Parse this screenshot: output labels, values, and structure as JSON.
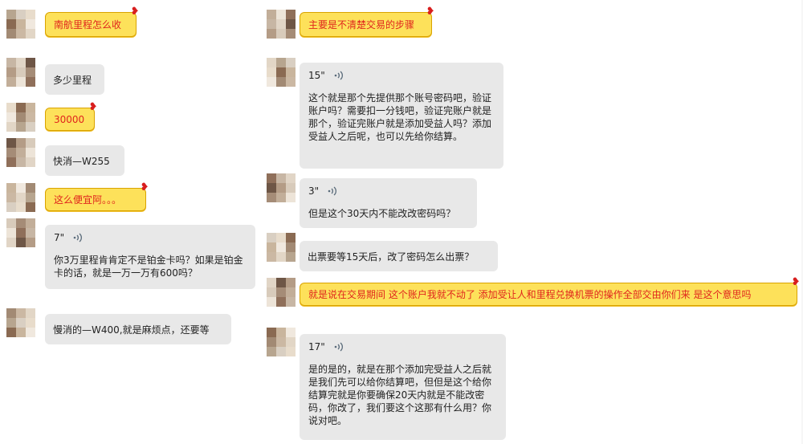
{
  "colors": {
    "gray_bubble": "#e8e8e8",
    "highlight_bubble": "#fde15a",
    "highlight_text": "#e0251d"
  },
  "icons": {
    "voice": "sound-wave-icon",
    "heart": "heart-icon",
    "avatar": "pixelated-avatar"
  },
  "left": [
    {
      "type": "highlight",
      "text": "南航里程怎么收"
    },
    {
      "type": "text",
      "text": "多少里程"
    },
    {
      "type": "highlight",
      "text": "30000"
    },
    {
      "type": "text",
      "text": "快消—W255"
    },
    {
      "type": "highlight",
      "text": "这么便宜阿。。。"
    },
    {
      "type": "voice",
      "duration": "7\"",
      "text": "你3万里程肯肯定不是铂金卡吗？如果是铂金卡的话，就是一万一万有600吗？"
    },
    {
      "type": "text",
      "text": "慢消的—W400,就是麻烦点，还要等"
    }
  ],
  "right": [
    {
      "type": "highlight",
      "text": "主要是不清楚交易的步骤"
    },
    {
      "type": "voice",
      "duration": "15\"",
      "text": "这个就是那个先提供那个账号密码吧，验证账户吗？需要扣一分钱吧，验证完账户就是那个，验证完账户就是添加受益人吗？添加受益人之后呢，也可以先给你结算。"
    },
    {
      "type": "voice",
      "duration": "3\"",
      "text": "但是这个30天内不能改改密码吗？"
    },
    {
      "type": "text",
      "text": "出票要等15天后，改了密码怎么出票？"
    },
    {
      "type": "highlight",
      "text": "就是说在交易期间  这个账户我就不动了 添加受让人和里程兑换机票的操作全部交由你们来 是这个意思吗"
    },
    {
      "type": "voice",
      "duration": "17\"",
      "text": "是的是的，就是在那个添加完受益人之后就是我们先可以给你结算吧，但但是这个给你结算完就是你要确保20天内就是不能改密码，你改了，我们要这个这那有什么用？你说对吧。"
    }
  ]
}
